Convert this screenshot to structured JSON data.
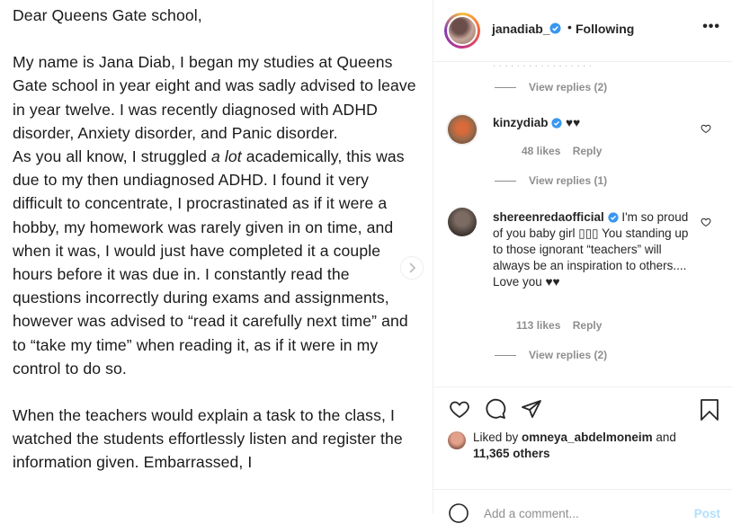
{
  "post": {
    "letter": {
      "salutation": "Dear Queens Gate school,",
      "p1": "My name is Jana Diab, I began my studies at Queens Gate school in year eight and was sadly advised to leave in year twelve. I was recently diagnosed with ADHD disorder, Anxiety disorder, and Panic disorder.",
      "p2_before": "As you all know, I struggled ",
      "p2_italic": "a lot",
      "p2_after": " academically, this was due to my then undiagnosed ADHD. I found it very difficult to concentrate, I procrastinated as if it were a hobby, my homework was rarely given in on time, and when it was, I would just have completed it a couple hours before it was due in. I constantly read the questions incorrectly during exams and assignments, however was advised to “read it carefully next time” and to “take my time” when reading it, as if it were in my control to do so.",
      "p3": "When the teachers would explain a task to the class, I watched the students effortlessly listen and register the information given. Embarrassed, I"
    }
  },
  "header": {
    "username": "janadiab_",
    "separator": "•",
    "follow_status": "Following"
  },
  "comments": [
    {
      "view_replies": "View replies (2)"
    },
    {
      "username": "kinzydiab",
      "text": "♥♥",
      "likes": "48 likes",
      "reply": "Reply",
      "view_replies": "View replies (1)"
    },
    {
      "username": "shereenredaofficial",
      "text": "I'm so proud of you baby girl ▯▯▯ You standing up to those ignorant “teachers” will always be an inspiration to others.... Love you ♥♥",
      "likes": "113 likes",
      "reply": "Reply",
      "view_replies": "View replies (2)"
    }
  ],
  "likes": {
    "prefix": "Liked by ",
    "user": "omneya_abdelmoneim",
    "middle": " and ",
    "others": "11,365 others"
  },
  "add_comment": {
    "placeholder": "Add a comment...",
    "post_label": "Post"
  },
  "icons": [
    "heart-icon",
    "comment-icon",
    "share-icon",
    "bookmark-icon",
    "emoji-icon",
    "verified-badge-icon",
    "more-options-icon",
    "chevron-right-icon"
  ],
  "colors": {
    "verified": "#3897f0",
    "muted": "#8e8e8e",
    "post_disabled": "#b2dffc"
  }
}
